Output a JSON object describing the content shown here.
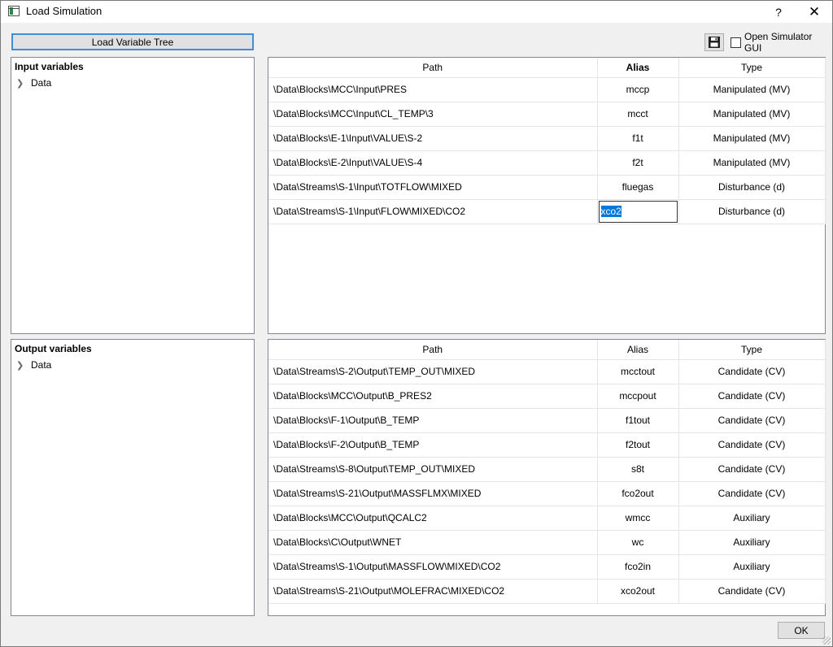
{
  "window": {
    "title": "Load Simulation",
    "help": "?",
    "close": "✕"
  },
  "toolbar": {
    "load_tree_label": "Load Variable Tree",
    "save_icon": "floppy-disk-icon",
    "open_gui_label": "Open Simulator GUI",
    "open_gui_checked": false
  },
  "input_tree": {
    "header": "Input variables",
    "root": "Data"
  },
  "output_tree": {
    "header": "Output variables",
    "root": "Data"
  },
  "input_table": {
    "columns": [
      "Path",
      "Alias",
      "Type"
    ],
    "rows": [
      {
        "path": "\\Data\\Blocks\\MCC\\Input\\PRES",
        "alias": "mccp",
        "type": "Manipulated (MV)"
      },
      {
        "path": "\\Data\\Blocks\\MCC\\Input\\CL_TEMP\\3",
        "alias": "mcct",
        "type": "Manipulated (MV)"
      },
      {
        "path": "\\Data\\Blocks\\E-1\\Input\\VALUE\\S-2",
        "alias": "f1t",
        "type": "Manipulated (MV)"
      },
      {
        "path": "\\Data\\Blocks\\E-2\\Input\\VALUE\\S-4",
        "alias": "f2t",
        "type": "Manipulated (MV)"
      },
      {
        "path": "\\Data\\Streams\\S-1\\Input\\TOTFLOW\\MIXED",
        "alias": "fluegas",
        "type": "Disturbance (d)"
      },
      {
        "path": "\\Data\\Streams\\S-1\\Input\\FLOW\\MIXED\\CO2",
        "alias": "xco2",
        "type": "Disturbance (d)"
      }
    ]
  },
  "output_table": {
    "columns": [
      "Path",
      "Alias",
      "Type"
    ],
    "rows": [
      {
        "path": "\\Data\\Streams\\S-2\\Output\\TEMP_OUT\\MIXED",
        "alias": "mcctout",
        "type": "Candidate (CV)"
      },
      {
        "path": "\\Data\\Blocks\\MCC\\Output\\B_PRES2",
        "alias": "mccpout",
        "type": "Candidate (CV)"
      },
      {
        "path": "\\Data\\Blocks\\F-1\\Output\\B_TEMP",
        "alias": "f1tout",
        "type": "Candidate (CV)"
      },
      {
        "path": "\\Data\\Blocks\\F-2\\Output\\B_TEMP",
        "alias": "f2tout",
        "type": "Candidate (CV)"
      },
      {
        "path": "\\Data\\Streams\\S-8\\Output\\TEMP_OUT\\MIXED",
        "alias": "s8t",
        "type": "Candidate (CV)"
      },
      {
        "path": "\\Data\\Streams\\S-21\\Output\\MASSFLMX\\MIXED",
        "alias": "fco2out",
        "type": "Candidate (CV)"
      },
      {
        "path": "\\Data\\Blocks\\MCC\\Output\\QCALC2",
        "alias": "wmcc",
        "type": "Auxiliary"
      },
      {
        "path": "\\Data\\Blocks\\C\\Output\\WNET",
        "alias": "wc",
        "type": "Auxiliary"
      },
      {
        "path": "\\Data\\Streams\\S-1\\Output\\MASSFLOW\\MIXED\\CO2",
        "alias": "fco2in",
        "type": "Auxiliary"
      },
      {
        "path": "\\Data\\Streams\\S-21\\Output\\MOLEFRAC\\MIXED\\CO2",
        "alias": "xco2out",
        "type": "Candidate (CV)"
      }
    ]
  },
  "footer": {
    "ok_label": "OK"
  }
}
